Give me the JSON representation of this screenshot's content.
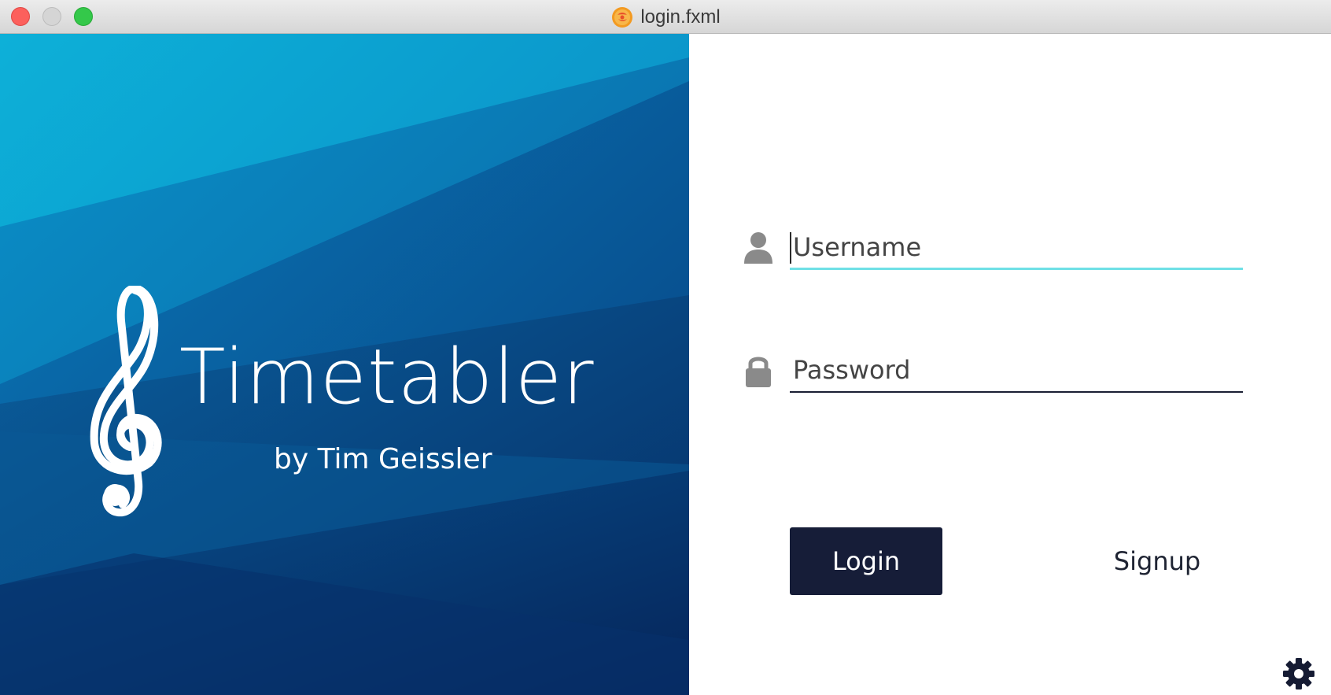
{
  "window": {
    "title": "login.fxml",
    "app_icon": "java-app-icon"
  },
  "banner": {
    "logo_icon": "treble-clef-icon",
    "app_name": "Timetabler",
    "byline": "by Tim Geissler",
    "colors": {
      "light": "#0aa0cf",
      "mid": "#0a6ba5",
      "dark": "#072e66"
    }
  },
  "form": {
    "username": {
      "icon": "user-icon",
      "placeholder": "Username",
      "value": ""
    },
    "password": {
      "icon": "lock-icon",
      "placeholder": "Password",
      "value": ""
    },
    "login_label": "Login",
    "signup_label": "Signup",
    "settings_icon": "gear-icon",
    "colors": {
      "focus_underline": "#6fe0e6",
      "button_bg": "#161d38"
    }
  }
}
